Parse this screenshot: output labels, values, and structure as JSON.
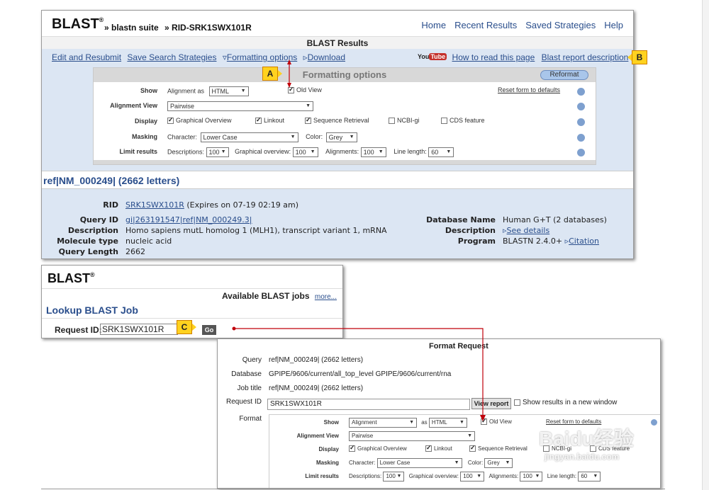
{
  "panel1": {
    "logo": "BLAST",
    "registered": "®",
    "breadcrumb1": "» blastn suite",
    "breadcrumb2": "» RID-SRK1SWX101R",
    "nav": [
      "Home",
      "Recent Results",
      "Saved Strategies",
      "Help"
    ],
    "results_title": "BLAST Results",
    "toolbar": {
      "edit": "Edit and Resubmit",
      "save": "Save Search Strategies",
      "formatting": "Formatting options",
      "download": "Download",
      "youtube": "You Tube",
      "how_to_read": "How to read this page",
      "report_desc": "Blast report description"
    },
    "formatting": {
      "title": "Formatting options",
      "reformat": "Reformat",
      "reset": "Reset form to defaults",
      "show_label": "Show",
      "show_text": "Alignment as",
      "show_value": "HTML",
      "old_view": "Old View",
      "alignment_view_label": "Alignment View",
      "alignment_view_value": "Pairwise",
      "display_label": "Display",
      "display_items": [
        "Graphical Overview",
        "Linkout",
        "Sequence Retrieval",
        "NCBI-gi",
        "CDS feature"
      ],
      "masking_label": "Masking",
      "character_label": "Character:",
      "character_value": "Lower Case",
      "color_label": "Color:",
      "color_value": "Grey",
      "limit_label": "Limit results",
      "descriptions_label": "Descriptions:",
      "descriptions_value": "100",
      "graphical_label": "Graphical overview:",
      "graphical_value": "100",
      "alignments_label": "Alignments:",
      "alignments_value": "100",
      "line_length_label": "Line length:",
      "line_length_value": "60"
    },
    "query_title": "ref|NM_000249| (2662 letters)",
    "summary": {
      "rid_label": "RID",
      "rid_value": "SRK1SWX101R",
      "rid_expires": "(Expires on 07-19 02:19 am)",
      "query_id_label": "Query ID",
      "query_id_value": "gi|263191547|ref|NM_000249.3|",
      "description_label": "Description",
      "description_value": "Homo sapiens mutL homolog 1 (MLH1), transcript variant 1, mRNA",
      "molecule_label": "Molecule type",
      "molecule_value": "nucleic acid",
      "length_label": "Query Length",
      "length_value": "2662",
      "db_name_label": "Database Name",
      "db_name_value": "Human G+T (2 databases)",
      "db_desc_label": "Description",
      "db_desc_value": "See details",
      "program_label": "Program",
      "program_value": "BLASTN 2.4.0+",
      "citation": "Citation"
    }
  },
  "panel2": {
    "logo": "BLAST",
    "registered": "®",
    "available": "Available BLAST jobs",
    "more": "more...",
    "lookup": "Lookup BLAST Job",
    "request_label": "Request ID:",
    "request_value": "SRK1SWX101R",
    "go": "Go"
  },
  "panel3": {
    "title": "Format Request",
    "query_label": "Query",
    "query_value": "ref|NM_000249| (2662 letters)",
    "database_label": "Database",
    "database_value": "GPIPE/9606/current/all_top_level GPIPE/9606/current/rna",
    "job_title_label": "Job title",
    "job_title_value": "ref|NM_000249| (2662 letters)",
    "request_label": "Request ID",
    "request_value": "SRK1SWX101R",
    "view_report": "View report",
    "new_window": "Show results in a new window",
    "format_label": "Format",
    "show_label": "Show",
    "show_value": "Alignment",
    "as_text": "as",
    "as_value": "HTML",
    "old_view": "Old View",
    "reset": "Reset form to defaults",
    "alignment_view_label": "Alignment View",
    "alignment_view_value": "Pairwise",
    "display_label": "Display",
    "display_items": [
      "Graphical Overview",
      "Linkout",
      "Sequence Retrieval",
      "NCBI-gi",
      "CDS feature"
    ],
    "masking_label": "Masking",
    "character_label": "Character:",
    "character_value": "Lower Case",
    "color_label": "Color:",
    "color_value": "Grey",
    "limit_label": "Limit results",
    "descriptions_label": "Descriptions:",
    "descriptions_value": "100",
    "graphical_label": "Graphical overview:",
    "graphical_value": "100",
    "alignments_label": "Alignments:",
    "alignments_value": "100",
    "line_length_label": "Line length:",
    "line_length_value": "60"
  },
  "callouts": {
    "a": "A",
    "b": "B",
    "c": "C"
  },
  "watermark": {
    "brand": "Baidu经验",
    "url": "jingyan.baidu.com"
  },
  "colors": {
    "accent": "#2a4e8c",
    "annotation_red": "#c0000b",
    "callout_yellow": "#ffd21f"
  }
}
